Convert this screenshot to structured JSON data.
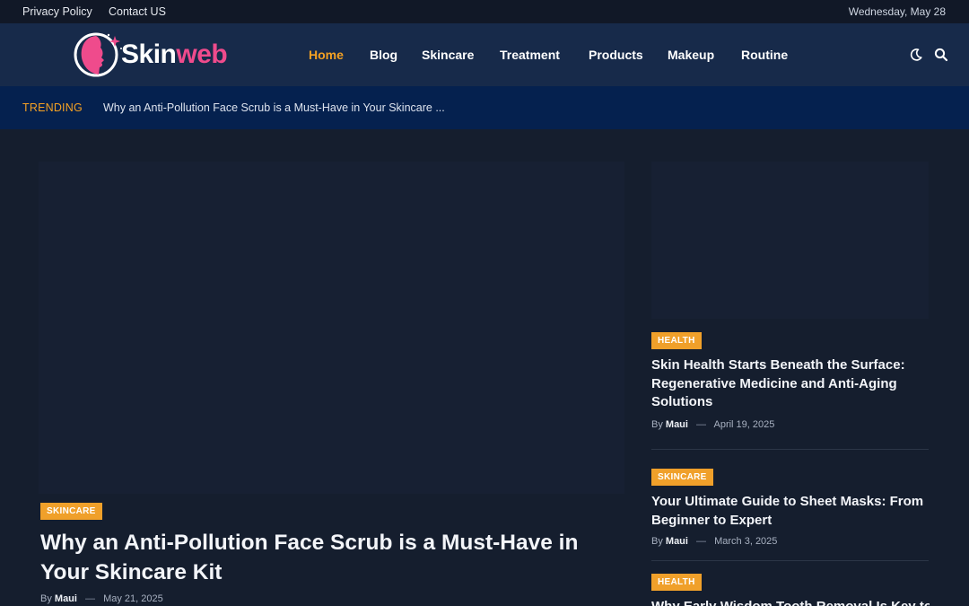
{
  "topbar": {
    "links": [
      "Privacy Policy",
      "Contact US"
    ],
    "date": "Wednesday, May 28"
  },
  "brand": {
    "name_part1": "Skin",
    "name_part2": "web",
    "primary_color": "#ef4b8c",
    "accent_color": "#f5a123"
  },
  "nav": {
    "items": [
      "Home",
      "Blog",
      "Skincare",
      "Treatment",
      "Products",
      "Makeup",
      "Routine"
    ],
    "active": "Home",
    "icons": [
      "moon-icon",
      "search-icon"
    ]
  },
  "trending": {
    "label": "TRENDING",
    "text": "Why an Anti-Pollution Face Scrub is a Must-Have in Your Skincare ..."
  },
  "featured": {
    "category": "SKINCARE",
    "title": "Why an Anti-Pollution Face Scrub is a Must-Have in Your Skincare Kit",
    "by": "By",
    "author": "Maui",
    "sep": "—",
    "date": "May 21, 2025"
  },
  "side_posts": [
    {
      "category": "HEALTH",
      "title": "Skin Health Starts Beneath the Surface: Regenerative Medicine and Anti-Aging Solutions",
      "by": "By",
      "author": "Maui",
      "sep": "—",
      "date": "April 19, 2025"
    },
    {
      "category": "SKINCARE",
      "title": "Your Ultimate Guide to Sheet Masks: From Beginner to Expert",
      "by": "By",
      "author": "Maui",
      "sep": "—",
      "date": "March 3, 2025"
    },
    {
      "category": "HEALTH",
      "title": "Why Early Wisdom Tooth Removal Is Key to"
    }
  ]
}
